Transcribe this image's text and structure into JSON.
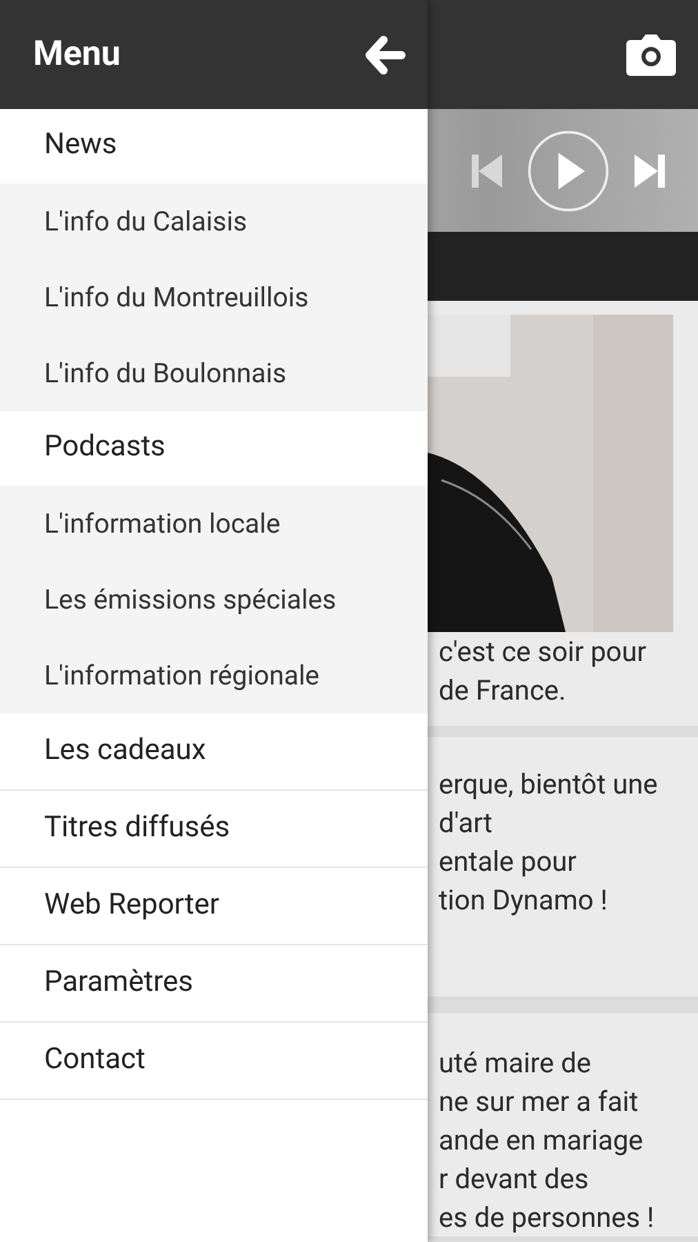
{
  "app_bar": {
    "title": "Menu"
  },
  "player": {
    "playing": false
  },
  "cards": [
    {
      "picture": {
        "kind": "picture"
      },
      "lines": [
        "c'est ce soir pour",
        "de France."
      ]
    },
    {
      "lines": [
        "erque, bientôt une",
        "d'art",
        "entale pour",
        "tion Dynamo !"
      ]
    },
    {
      "lines": [
        "uté maire de",
        "ne sur mer a fait",
        "ande en mariage",
        "r devant des",
        "es de personnes !"
      ]
    }
  ],
  "menu": [
    {
      "label": "News",
      "children": [
        {
          "label": "L'info du Calaisis"
        },
        {
          "label": "L'info du Montreuillois"
        },
        {
          "label": "L'info du Boulonnais"
        }
      ]
    },
    {
      "label": "Podcasts",
      "children": [
        {
          "label": "L'information locale"
        },
        {
          "label": "Les émissions spéciales"
        },
        {
          "label": "L'information régionale"
        }
      ]
    },
    {
      "label": "Les cadeaux"
    },
    {
      "label": "Titres diffusés"
    },
    {
      "label": "Web Reporter"
    },
    {
      "label": "Paramètres"
    },
    {
      "label": "Contact"
    }
  ]
}
